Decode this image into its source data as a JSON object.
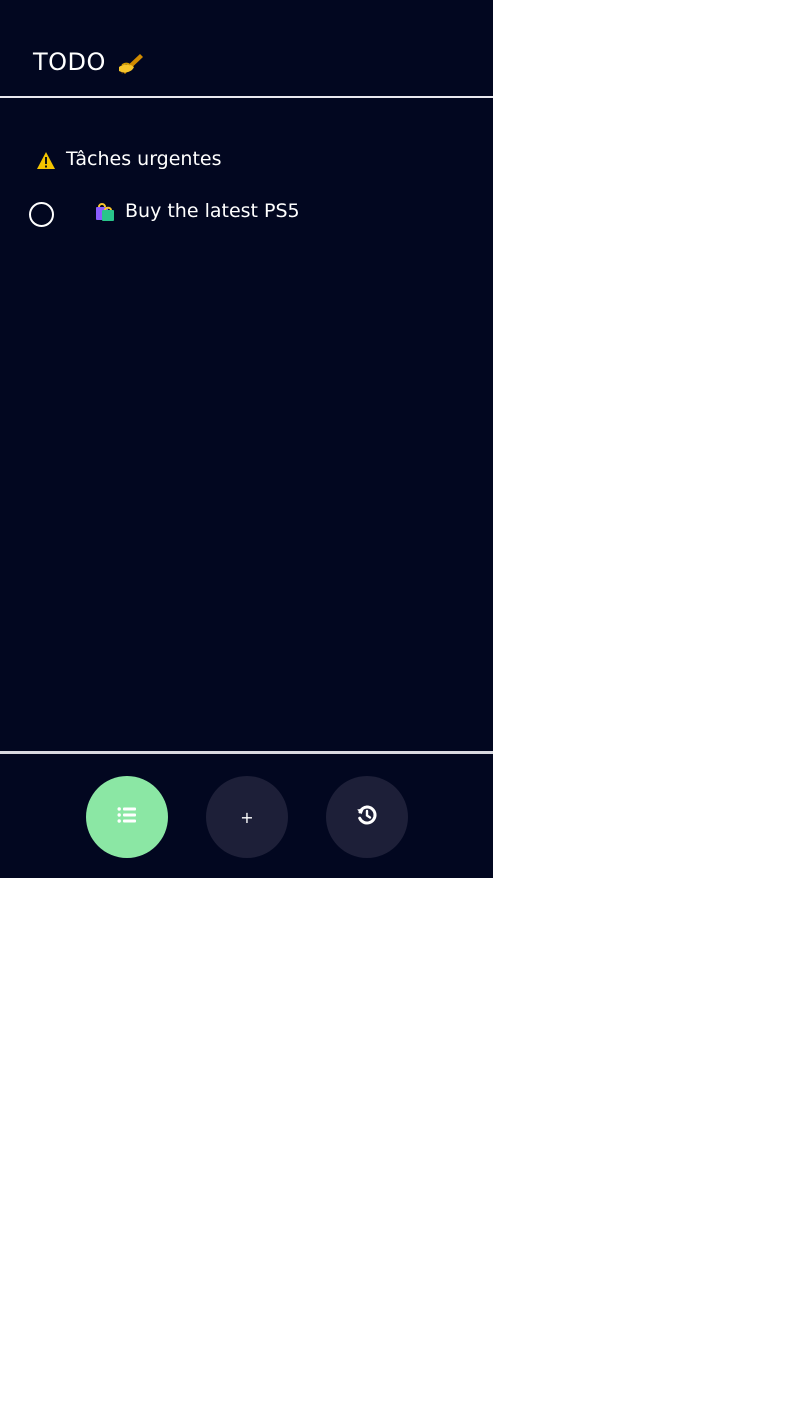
{
  "header": {
    "title": "TODO",
    "title_icon": "writing-hand-icon"
  },
  "section": {
    "title": "Tâches urgentes",
    "icon": "warning-icon"
  },
  "tasks": [
    {
      "label": "Buy the latest PS5",
      "icon": "shopping-bags-icon",
      "completed": false
    }
  ],
  "nav": {
    "items": [
      {
        "icon": "list-icon",
        "active": true
      },
      {
        "label": "+",
        "icon": "plus-icon",
        "active": false
      },
      {
        "icon": "history-icon",
        "active": false
      }
    ]
  },
  "colors": {
    "background": "#020720",
    "active_nav": "#8be7a4",
    "inactive_nav": "#1d1f38",
    "warning": "#f4c400"
  }
}
